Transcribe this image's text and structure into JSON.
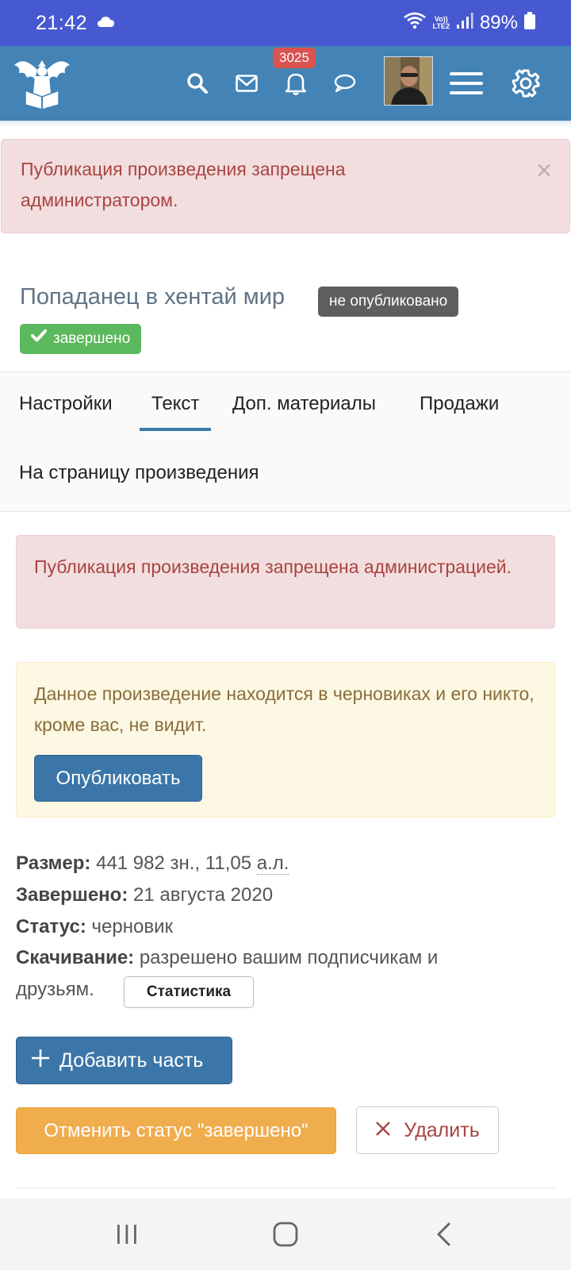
{
  "status_bar": {
    "time": "21:42",
    "network_line1": "Vo))",
    "network_line2": "LTE2",
    "battery": "89%",
    "icons": [
      "cloud-icon",
      "wifi-icon",
      "signal-icon",
      "battery-icon"
    ]
  },
  "header": {
    "notification_count": "3025",
    "icons": [
      "logo-eagle-icon",
      "search-icon",
      "mail-icon",
      "bell-icon",
      "chat-icon",
      "avatar",
      "menu-icon",
      "gear-icon"
    ],
    "bg_color": "#4383b5"
  },
  "alert_top": {
    "text": "Публикация произведения запрещена администратором.",
    "close": "×"
  },
  "work": {
    "title": "Попаданец в хентай мир",
    "label_unpublished": "не опубликовано",
    "label_completed": "завершено"
  },
  "tabs": {
    "items": [
      {
        "label": "Настройки"
      },
      {
        "label": "Текст"
      },
      {
        "label": "Доп. материалы"
      },
      {
        "label": "Продажи"
      }
    ],
    "active": "Текст",
    "work_page_link": "На страницу произведения"
  },
  "alert_mid": {
    "text": "Публикация произведения запрещена администрацией."
  },
  "alert_draft": {
    "text": "Данное произведение находится в черновиках и его никто, кроме вас, не видит.",
    "publish_button": "Опубликовать"
  },
  "info": {
    "size_label": "Размер:",
    "size_value": "441 982 зн., 11,05",
    "size_unit": "а.л.",
    "completed_label": "Завершено:",
    "completed_value": "21 августа 2020",
    "status_label": "Статус:",
    "status_value": "черновик",
    "download_label": "Скачивание:",
    "download_value_line1": "разрешено вашим подписчикам и",
    "download_value_line2": "друзьям.",
    "stats_button": "Статистика"
  },
  "actions": {
    "add_part": "Добавить часть",
    "cancel_completed": "Отменить статус \"завершено\"",
    "delete": "Удалить"
  },
  "colors": {
    "status_bar": "#4759d1",
    "primary": "#3c76a8",
    "danger_bg": "#f2dede",
    "danger_text": "#a94442",
    "warning_bg": "#fcf8e3",
    "warning_text": "#8a6d3b",
    "success": "#5cb85c",
    "orange": "#f0ad4e"
  }
}
